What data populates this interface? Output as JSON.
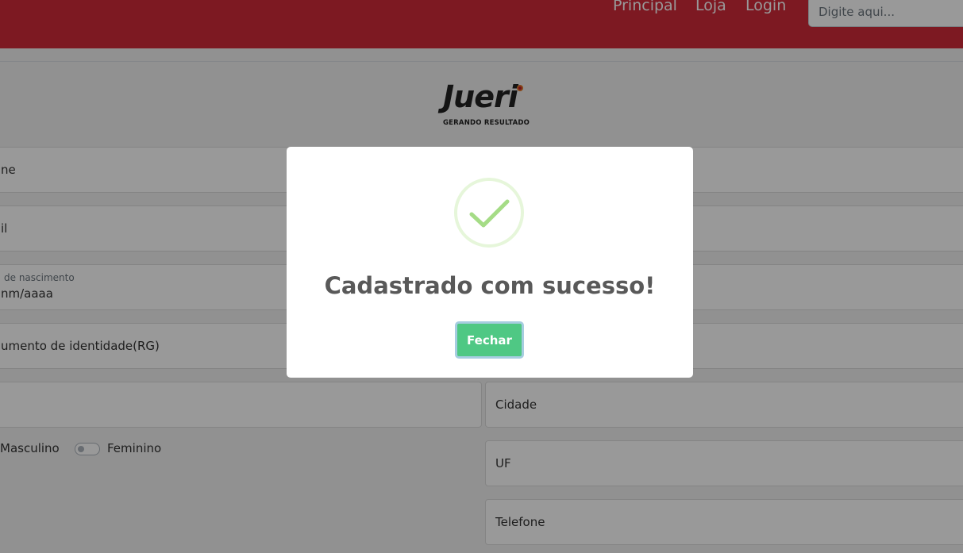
{
  "nav": {
    "links": [
      "Principal",
      "Loja",
      "Login"
    ],
    "search_placeholder": "Digite aqui..."
  },
  "logo": {
    "word": "Jueri",
    "tagline": "GERANDO RESULTADO"
  },
  "form": {
    "nome_label": "ne",
    "email_label": "il",
    "nascimento_label": "de nascimento",
    "nascimento_placeholder": "nm/aaaa",
    "rg_label": "umento de identidade(RG)",
    "cidade_label": "Cidade",
    "uf_label": "UF",
    "telefone_label": "Telefone",
    "sexo_masculino": "Masculino",
    "sexo_feminino": "Feminino"
  },
  "modal": {
    "title": "Cadastrado com sucesso!",
    "close_label": "Fechar",
    "icon": "check-circle-icon"
  },
  "colors": {
    "topbar": "#d02a3a",
    "success": "#4fc884",
    "check": "#a5dc86"
  }
}
